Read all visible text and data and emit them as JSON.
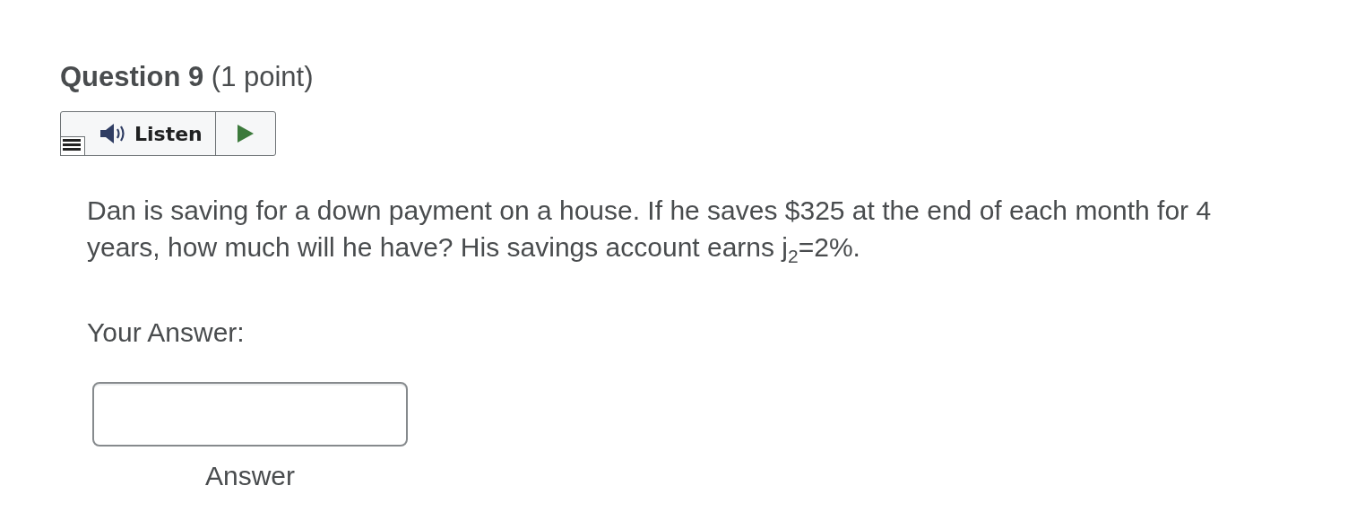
{
  "question": {
    "heading": "**Question 9** (1 point)"
  },
  "listen_toolbar": {
    "label": "Listen"
  },
  "prompt": "Dan is saving for a down payment on a house. If he saves $325 at the end of each month for 4 years, how much will he have? His savings account earns j$_{2}$=2%.",
  "answer": {
    "label": "Your Answer:",
    "caption": "Answer"
  }
}
